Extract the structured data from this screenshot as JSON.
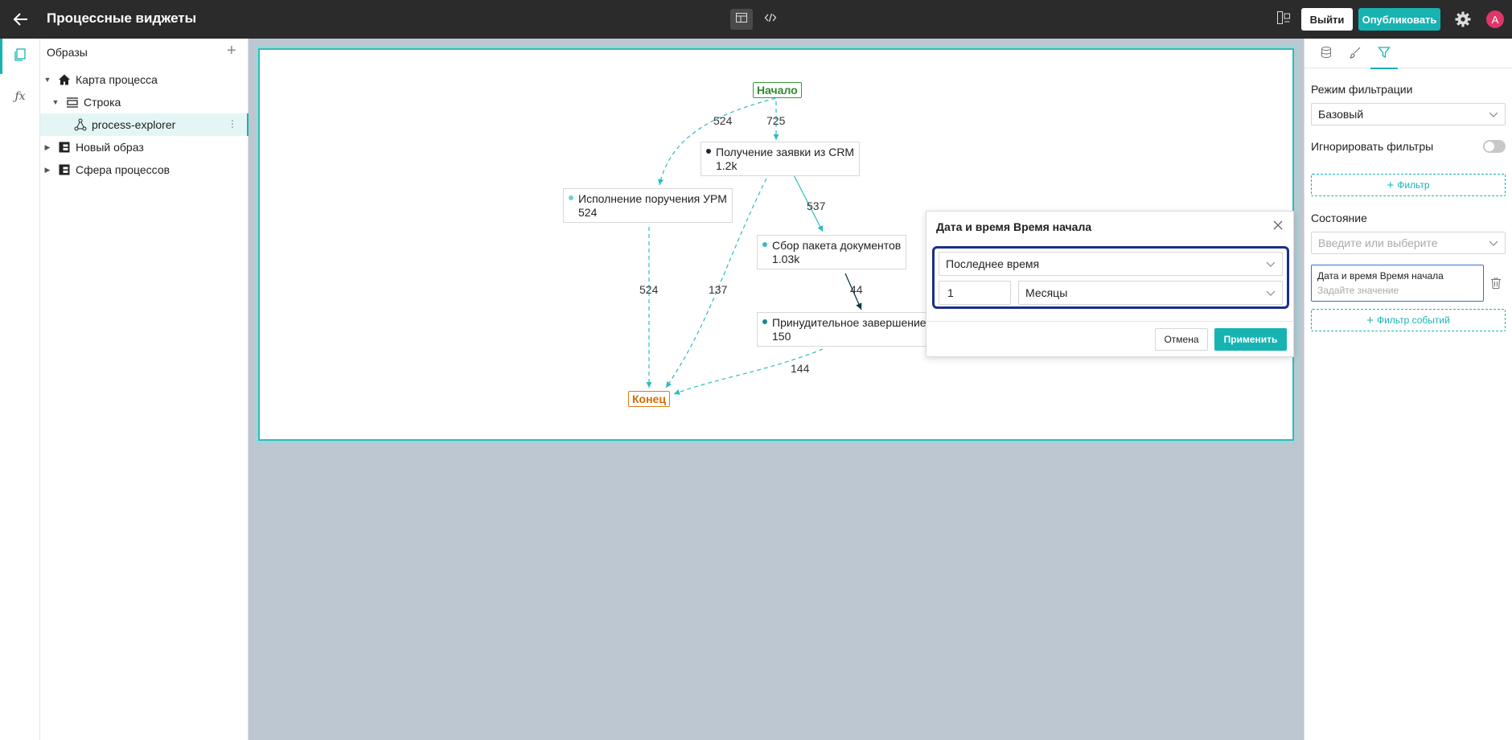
{
  "header": {
    "title": "Процессные виджеты",
    "exit_label": "Выйти",
    "publish_label": "Опубликовать",
    "avatar_letter": "A",
    "accent_color": "#17b3b3"
  },
  "tree": {
    "header": "Образы",
    "items": [
      {
        "label": "Карта процесса"
      },
      {
        "label": "Строка"
      },
      {
        "label": "process-explorer"
      },
      {
        "label": "Новый образ"
      },
      {
        "label": "Сфера процессов"
      }
    ]
  },
  "process_map": {
    "start_label": "Начало",
    "end_label": "Конец",
    "nodes": [
      {
        "name": "Получение заявки из CRM",
        "count": "1.2k"
      },
      {
        "name": "Исполнение поручения УРМ",
        "count": "524"
      },
      {
        "name": "Сбор пакета документов",
        "count": "1.03k"
      },
      {
        "name": "Принудительное завершение",
        "count": "150"
      }
    ],
    "edge_labels": [
      "524",
      "725",
      "537",
      "524",
      "137",
      "44",
      "144"
    ]
  },
  "filter_popover": {
    "title": "Дата и время Время начала",
    "period_select": "Последнее время",
    "amount_value": "1",
    "unit_select": "Месяцы",
    "cancel_label": "Отмена",
    "apply_label": "Применить"
  },
  "right_panel": {
    "filter_mode_label": "Режим фильтрации",
    "filter_mode_value": "Базовый",
    "ignore_filters_label": "Игнорировать фильтры",
    "ignore_filters_on": false,
    "add_filter_label": "Фильтр",
    "state_label": "Состояние",
    "state_placeholder": "Введите или выберите",
    "filter_card_title": "Дата и время Время начала",
    "filter_card_placeholder": "Задайте значение",
    "add_event_filter_label": "Фильтр событий"
  }
}
